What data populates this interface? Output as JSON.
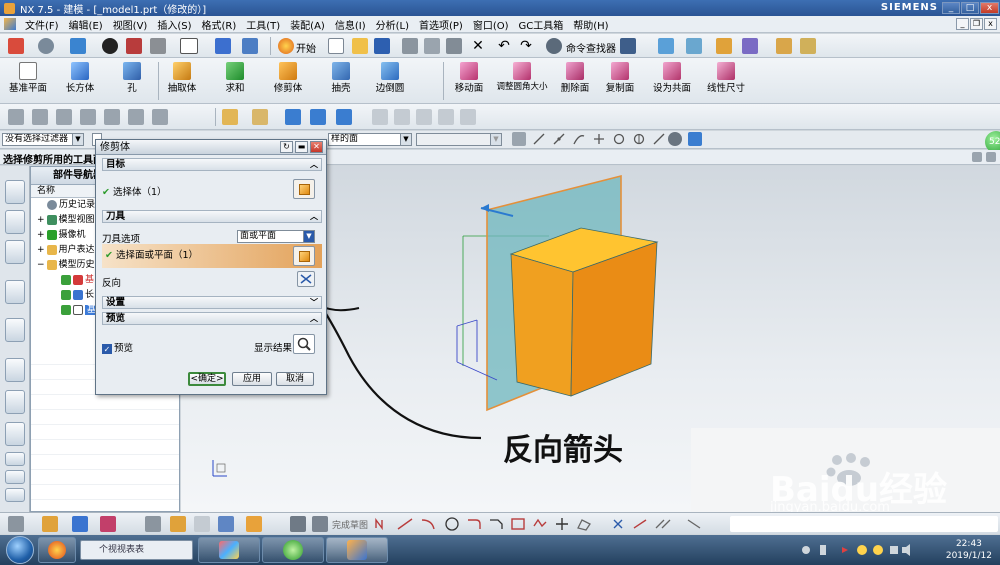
{
  "window": {
    "title": "NX 7.5 - 建模 - [_model1.prt（修改的）]",
    "brand": "SIEMENS",
    "controls": [
      "_",
      "□",
      "x"
    ]
  },
  "menu": [
    "文件(F)",
    "编辑(E)",
    "视图(V)",
    "插入(S)",
    "格式(R)",
    "工具(T)",
    "装配(A)",
    "信息(I)",
    "分析(L)",
    "首选项(P)",
    "窗口(O)",
    "GC工具箱",
    "帮助(H)"
  ],
  "toolbar_top": {
    "start_label": "开始",
    "command_finder": "命令查找器"
  },
  "toolbar_main": [
    {
      "label": "基准平面",
      "icon": "datum-plane-icon"
    },
    {
      "label": "长方体",
      "icon": "block-icon"
    },
    {
      "label": "孔",
      "icon": "hole-icon"
    },
    {
      "label": "抽取体",
      "icon": "extract-body-icon"
    },
    {
      "label": "求和",
      "icon": "unite-icon"
    },
    {
      "label": "修剪体",
      "icon": "trim-body-icon"
    },
    {
      "label": "抽壳",
      "icon": "shell-icon"
    },
    {
      "label": "边倒圆",
      "icon": "edge-blend-icon"
    },
    {
      "label": "移动面",
      "icon": "move-face-icon"
    },
    {
      "label": "调整圆角大小",
      "icon": "resize-blend-icon"
    },
    {
      "label": "删除面",
      "icon": "delete-face-icon"
    },
    {
      "label": "复制面",
      "icon": "copy-face-icon"
    },
    {
      "label": "设为共面",
      "icon": "make-coplanar-icon"
    },
    {
      "label": "线性尺寸",
      "icon": "linear-dimension-icon"
    }
  ],
  "selection_bar": {
    "filter": "没有选择过滤器",
    "face_rule": "样的面"
  },
  "cue_line": "选择修剪所用的工具面",
  "navigator": {
    "title": "部件导航器",
    "column": "名称",
    "rows": [
      {
        "label": "历史记录",
        "indent": 1
      },
      {
        "label": "模型视图",
        "indent": 0
      },
      {
        "label": "摄像机",
        "indent": 0
      },
      {
        "label": "用户表达",
        "indent": 0
      },
      {
        "label": "模型历史",
        "indent": 0
      },
      {
        "label": "基",
        "indent": 2
      },
      {
        "label": "长",
        "indent": 2
      },
      {
        "label": "基",
        "indent": 2
      }
    ]
  },
  "dialog": {
    "title": "修剪体",
    "sections": {
      "target": "目标",
      "tool": "刀具",
      "settings": "设置",
      "preview": "预览"
    },
    "target_row": "选择体（1）",
    "tool_option_label": "刀具选项",
    "tool_option_value": "面或平面",
    "tool_face_row": "选择面或平面（1）",
    "reverse_label": "反向",
    "preview_label": "预览",
    "show_result_label": "显示结果",
    "buttons": {
      "ok": "<确定>",
      "apply": "应用",
      "cancel": "取消"
    }
  },
  "bottom_toolbar": {
    "finish_sketch": "完成草图"
  },
  "annotation": "反向箭头",
  "watermark": {
    "text": "Baidu经验",
    "url": "jingyan.baidu.com"
  },
  "taskbar": {
    "search_placeholder": "个视视表表",
    "time": "22:43",
    "date": "2019/1/12"
  },
  "green_badge": "52",
  "colors": {
    "cube_orange": "#f0a020",
    "plane_teal": "#6fb7bd",
    "accent_blue": "#2a5494"
  }
}
